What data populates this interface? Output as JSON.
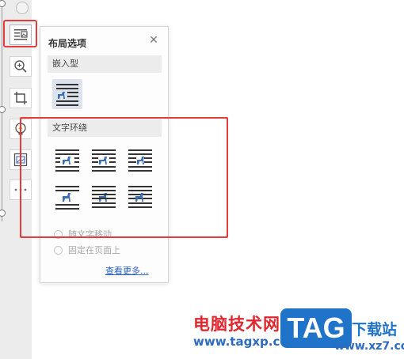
{
  "panel": {
    "title": "布局选项",
    "close_icon": "close-icon",
    "inline_section": "嵌入型",
    "wrap_section": "文字环绕",
    "move_with_text": "随文字移动",
    "fix_on_page": "固定在页面上",
    "see_more": "查看更多..."
  },
  "toolbar": {
    "icons": [
      "minus-circle-icon",
      "layout-options-icon",
      "zoom-in-icon",
      "crop-icon",
      "lightbulb-icon",
      "image-frame-icon",
      "more-icon"
    ]
  },
  "watermark": {
    "site_name": "电脑技术网",
    "site_url": "www.tagxp.com",
    "tag_logo": "TAG",
    "tag_text": "下载站",
    "tag_url": "www.xz7.com"
  },
  "colors": {
    "highlight_border": "#e53b3b",
    "icon_blue": "#3d6fb5",
    "link_blue": "#2a62c9",
    "watermark_red": "#e0272e",
    "tag_blue": "#1f74c9"
  }
}
